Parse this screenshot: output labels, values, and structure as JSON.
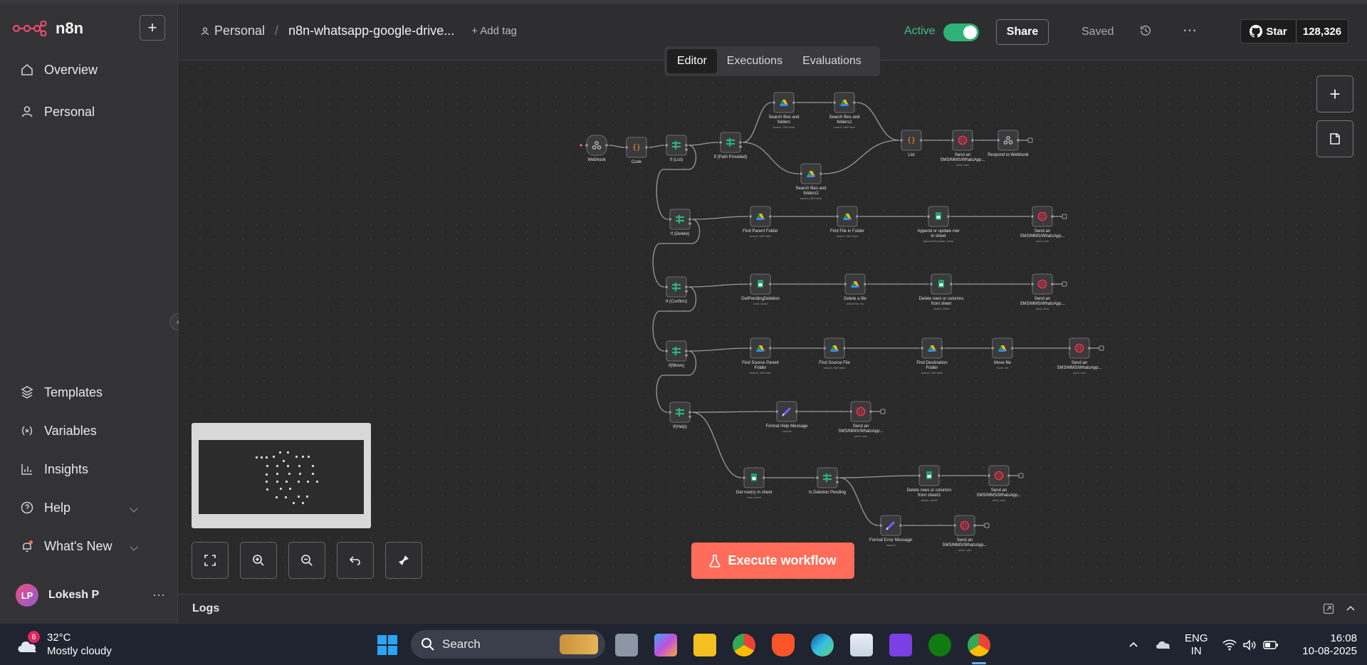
{
  "app": {
    "name": "n8n"
  },
  "sidebar": {
    "add_label": "+",
    "nav_top": [
      {
        "label": "Overview",
        "icon": "home-icon"
      },
      {
        "label": "Personal",
        "icon": "user-icon"
      }
    ],
    "nav_bottom": [
      {
        "label": "Templates",
        "icon": "templates-icon"
      },
      {
        "label": "Variables",
        "icon": "variables-icon"
      },
      {
        "label": "Insights",
        "icon": "insights-icon"
      },
      {
        "label": "Help",
        "icon": "help-icon"
      },
      {
        "label": "What's New",
        "icon": "bell-icon"
      }
    ],
    "user": {
      "initials": "LP",
      "name": "Lokesh P",
      "more": "⋯"
    }
  },
  "header": {
    "project": "Personal",
    "separator": "/",
    "workflow_name": "n8n-whatsapp-google-drive...",
    "add_tag": "+ Add tag",
    "active_label": "Active",
    "share_label": "Share",
    "saved_label": "Saved",
    "more": "⋯",
    "github": {
      "star_label": "Star",
      "count": "128,326"
    }
  },
  "tabs": [
    {
      "label": "Editor",
      "active": true
    },
    {
      "label": "Executions",
      "active": false
    },
    {
      "label": "Evaluations",
      "active": false
    }
  ],
  "canvas": {
    "execute_label": "Execute workflow",
    "nodes": [
      {
        "label": "Webhook",
        "type": "webhook",
        "color": "#bdbdbd"
      },
      {
        "label": "Code",
        "type": "code",
        "color": "#ff9922"
      },
      {
        "label": "If (List)",
        "type": "if",
        "color": "#2fb277"
      },
      {
        "label": "If (Path Provided)",
        "type": "if",
        "color": "#2fb277"
      },
      {
        "label": "Search files and folders",
        "sub": "search: fileFolder",
        "type": "gdrive",
        "color": "#4285f4"
      },
      {
        "label": "Search files and folders1",
        "sub": "search: fileFolder",
        "type": "gdrive",
        "color": "#4285f4"
      },
      {
        "label": "Search files and folders2",
        "sub": "search: fileFolder",
        "type": "gdrive",
        "color": "#4285f4"
      },
      {
        "label": "List",
        "type": "code",
        "color": "#ff9922"
      },
      {
        "label": "Send an SMS/MMS/WhatsApp...",
        "sub": "send: sms",
        "type": "twilio",
        "color": "#f22f46"
      },
      {
        "label": "Respond to Webhook",
        "type": "webhook",
        "color": "#bdbdbd"
      },
      {
        "label": "If (Delete)",
        "type": "if",
        "color": "#2fb277"
      },
      {
        "label": "Find Parent Folder",
        "sub": "search: fileFolder",
        "type": "gdrive",
        "color": "#4285f4"
      },
      {
        "label": "Find File in Folder",
        "sub": "search: fileFolder",
        "type": "gdrive",
        "color": "#4285f4"
      },
      {
        "label": "Append or update row in sheet",
        "sub": "appendOrUpdate: sheet",
        "type": "gsheets",
        "color": "#21a366"
      },
      {
        "label": "Send an SMS/MMS/WhatsApp...",
        "sub": "send: sms",
        "type": "twilio",
        "color": "#f22f46"
      },
      {
        "label": "If (Confirm)",
        "type": "if",
        "color": "#2fb277"
      },
      {
        "label": "GetPendingDeletion",
        "sub": "read: sheet",
        "type": "gsheets",
        "color": "#21a366"
      },
      {
        "label": "Delete a file",
        "sub": "deleteFile: file",
        "type": "gdrive",
        "color": "#4285f4"
      },
      {
        "label": "Delete rows or columns from sheet",
        "sub": "delete: sheet",
        "type": "gsheets",
        "color": "#21a366"
      },
      {
        "label": "Send an SMS/MMS/WhatsApp...",
        "sub": "send: sms",
        "type": "twilio",
        "color": "#f22f46"
      },
      {
        "label": "If(Move)",
        "type": "if",
        "color": "#2fb277"
      },
      {
        "label": "Find Source Parent Folder",
        "sub": "search: fileFolder",
        "type": "gdrive",
        "color": "#4285f4"
      },
      {
        "label": "Find Source File",
        "sub": "search: fileFolder",
        "type": "gdrive",
        "color": "#4285f4"
      },
      {
        "label": "Find Destination Folder",
        "sub": "search: fileFolder",
        "type": "gdrive",
        "color": "#4285f4"
      },
      {
        "label": "Move file",
        "sub": "move: file",
        "type": "gdrive",
        "color": "#4285f4"
      },
      {
        "label": "Send an SMS/MMS/WhatsApp...",
        "sub": "send: sms",
        "type": "twilio",
        "color": "#f22f46"
      },
      {
        "label": "If(Help)",
        "type": "if",
        "color": "#2fb277"
      },
      {
        "label": "Format Help Message",
        "sub": "manual",
        "type": "set",
        "color": "#7b61ff"
      },
      {
        "label": "Send an SMS/MMS/WhatsApp...",
        "sub": "send: sms",
        "type": "twilio",
        "color": "#f22f46"
      },
      {
        "label": "Get row(s) in sheet",
        "sub": "read: sheet",
        "type": "gsheets",
        "color": "#21a366"
      },
      {
        "label": "Is Deletion Pending",
        "type": "if",
        "color": "#2fb277"
      },
      {
        "label": "Delete rows or columns from sheet1",
        "sub": "delete: sheet",
        "type": "gsheets",
        "color": "#21a366"
      },
      {
        "label": "Send an SMS/MMS/WhatsApp...",
        "sub": "send: sms",
        "type": "twilio",
        "color": "#f22f46"
      },
      {
        "label": "Format Error Message",
        "sub": "manual",
        "type": "set",
        "color": "#7b61ff"
      },
      {
        "label": "Send an SMS/MMS/WhatsApp...",
        "sub": "send: sms",
        "type": "twilio",
        "color": "#f22f46"
      }
    ]
  },
  "logs": {
    "label": "Logs"
  },
  "taskbar": {
    "weather": {
      "badge": "6",
      "temp": "32°C",
      "desc": "Mostly cloudy"
    },
    "search_label": "Search",
    "lang_line1": "ENG",
    "lang_line2": "IN",
    "time": "16:08",
    "date": "10-08-2025"
  }
}
